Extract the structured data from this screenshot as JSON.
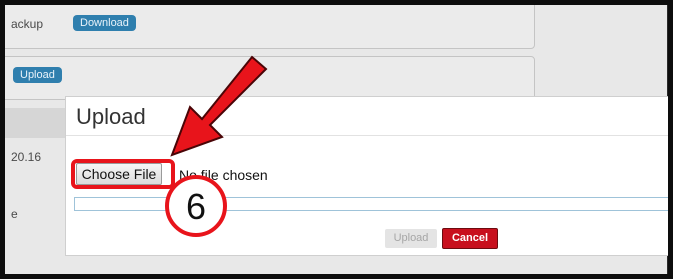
{
  "background": {
    "backup_label": "ackup",
    "download_button": "Download",
    "upload_button": "Upload",
    "version_text": "20.16",
    "partial_text": "e"
  },
  "modal": {
    "title": "Upload",
    "choose_file_label": "Choose File",
    "file_status": "No file chosen",
    "upload_progress": 0,
    "upload_label": "Upload",
    "cancel_label": "Cancel"
  },
  "annotation": {
    "step_number": "6",
    "color": "#e8141b"
  }
}
